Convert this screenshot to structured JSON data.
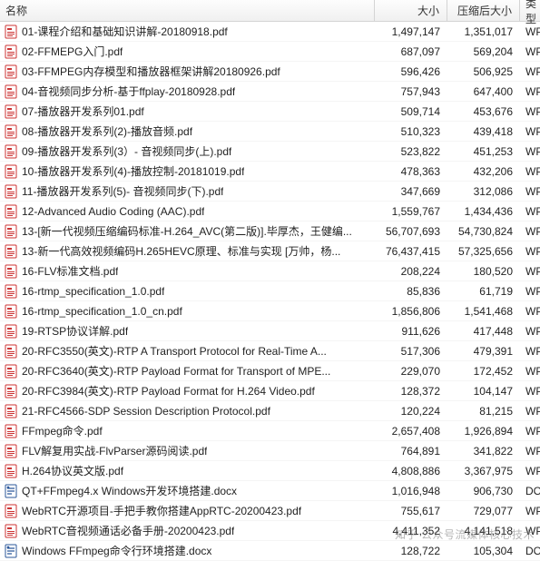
{
  "columns": {
    "name": "名称",
    "size": "大小",
    "compressed": "压缩后大小",
    "type": "类型"
  },
  "files": [
    {
      "name": "01-课程介绍和基础知识讲解-20180918.pdf",
      "size": "1,497,147",
      "compressed": "1,351,017",
      "type": "WPS P",
      "ext": "pdf"
    },
    {
      "name": "02-FFMEPG入门.pdf",
      "size": "687,097",
      "compressed": "569,204",
      "type": "WPS P",
      "ext": "pdf"
    },
    {
      "name": "03-FFMPEG内存模型和播放器框架讲解20180926.pdf",
      "size": "596,426",
      "compressed": "506,925",
      "type": "WPS P",
      "ext": "pdf"
    },
    {
      "name": "04-音视频同步分析-基于ffplay-20180928.pdf",
      "size": "757,943",
      "compressed": "647,400",
      "type": "WPS P",
      "ext": "pdf"
    },
    {
      "name": "07-播放器开发系列01.pdf",
      "size": "509,714",
      "compressed": "453,676",
      "type": "WPS P",
      "ext": "pdf"
    },
    {
      "name": "08-播放器开发系列(2)-播放音频.pdf",
      "size": "510,323",
      "compressed": "439,418",
      "type": "WPS P",
      "ext": "pdf"
    },
    {
      "name": "09-播放器开发系列(3）- 音视频同步(上).pdf",
      "size": "523,822",
      "compressed": "451,253",
      "type": "WPS P",
      "ext": "pdf"
    },
    {
      "name": "10-播放器开发系列(4)-播放控制-20181019.pdf",
      "size": "478,363",
      "compressed": "432,206",
      "type": "WPS P",
      "ext": "pdf"
    },
    {
      "name": "11-播放器开发系列(5)- 音视频同步(下).pdf",
      "size": "347,669",
      "compressed": "312,086",
      "type": "WPS P",
      "ext": "pdf"
    },
    {
      "name": "12-Advanced Audio Coding (AAC).pdf",
      "size": "1,559,767",
      "compressed": "1,434,436",
      "type": "WPS P",
      "ext": "pdf"
    },
    {
      "name": "13-[新一代视频压缩编码标准-H.264_AVC(第二版)].毕厚杰，王健编...",
      "size": "56,707,693",
      "compressed": "54,730,824",
      "type": "WPS P",
      "ext": "pdf"
    },
    {
      "name": "13-新一代高效视频编码H.265HEVC原理、标准与实现 [万帅，杨...",
      "size": "76,437,415",
      "compressed": "57,325,656",
      "type": "WPS P",
      "ext": "pdf"
    },
    {
      "name": "16-FLV标准文档.pdf",
      "size": "208,224",
      "compressed": "180,520",
      "type": "WPS P",
      "ext": "pdf"
    },
    {
      "name": "16-rtmp_specification_1.0.pdf",
      "size": "85,836",
      "compressed": "61,719",
      "type": "WPS P",
      "ext": "pdf"
    },
    {
      "name": "16-rtmp_specification_1.0_cn.pdf",
      "size": "1,856,806",
      "compressed": "1,541,468",
      "type": "WPS P",
      "ext": "pdf"
    },
    {
      "name": "19-RTSP协议详解.pdf",
      "size": "911,626",
      "compressed": "417,448",
      "type": "WPS P",
      "ext": "pdf"
    },
    {
      "name": "20-RFC3550(英文)-RTP A Transport Protocol for Real-Time A...",
      "size": "517,306",
      "compressed": "479,391",
      "type": "WPS P",
      "ext": "pdf"
    },
    {
      "name": "20-RFC3640(英文)-RTP Payload Format for Transport of MPE...",
      "size": "229,070",
      "compressed": "172,452",
      "type": "WPS P",
      "ext": "pdf"
    },
    {
      "name": "20-RFC3984(英文)-RTP Payload Format for H.264 Video.pdf",
      "size": "128,372",
      "compressed": "104,147",
      "type": "WPS P",
      "ext": "pdf"
    },
    {
      "name": "21-RFC4566-SDP Session  Description  Protocol.pdf",
      "size": "120,224",
      "compressed": "81,215",
      "type": "WPS P",
      "ext": "pdf"
    },
    {
      "name": "FFmpeg命令.pdf",
      "size": "2,657,408",
      "compressed": "1,926,894",
      "type": "WPS P",
      "ext": "pdf"
    },
    {
      "name": "FLV解复用实战-FlvParser源码阅读.pdf",
      "size": "764,891",
      "compressed": "341,822",
      "type": "WPS P",
      "ext": "pdf"
    },
    {
      "name": "H.264协议英文版.pdf",
      "size": "4,808,886",
      "compressed": "3,367,975",
      "type": "WPS P",
      "ext": "pdf"
    },
    {
      "name": "QT+FFmpeg4.x Windows开发环境搭建.docx",
      "size": "1,016,948",
      "compressed": "906,730",
      "type": "DOCX",
      "ext": "docx"
    },
    {
      "name": "WebRTC开源项目-手把手教你搭建AppRTC-20200423.pdf",
      "size": "755,617",
      "compressed": "729,077",
      "type": "WPS P",
      "ext": "pdf"
    },
    {
      "name": "WebRTC音视频通话必备手册-20200423.pdf",
      "size": "4,411,352",
      "compressed": "4,141,518",
      "type": "WPS P",
      "ext": "pdf"
    },
    {
      "name": "Windows FFmpeg命令行环境搭建.docx",
      "size": "128,722",
      "compressed": "105,304",
      "type": "DOCX",
      "ext": "docx"
    }
  ],
  "watermark": "知乎 公众号流媒体核心技术"
}
